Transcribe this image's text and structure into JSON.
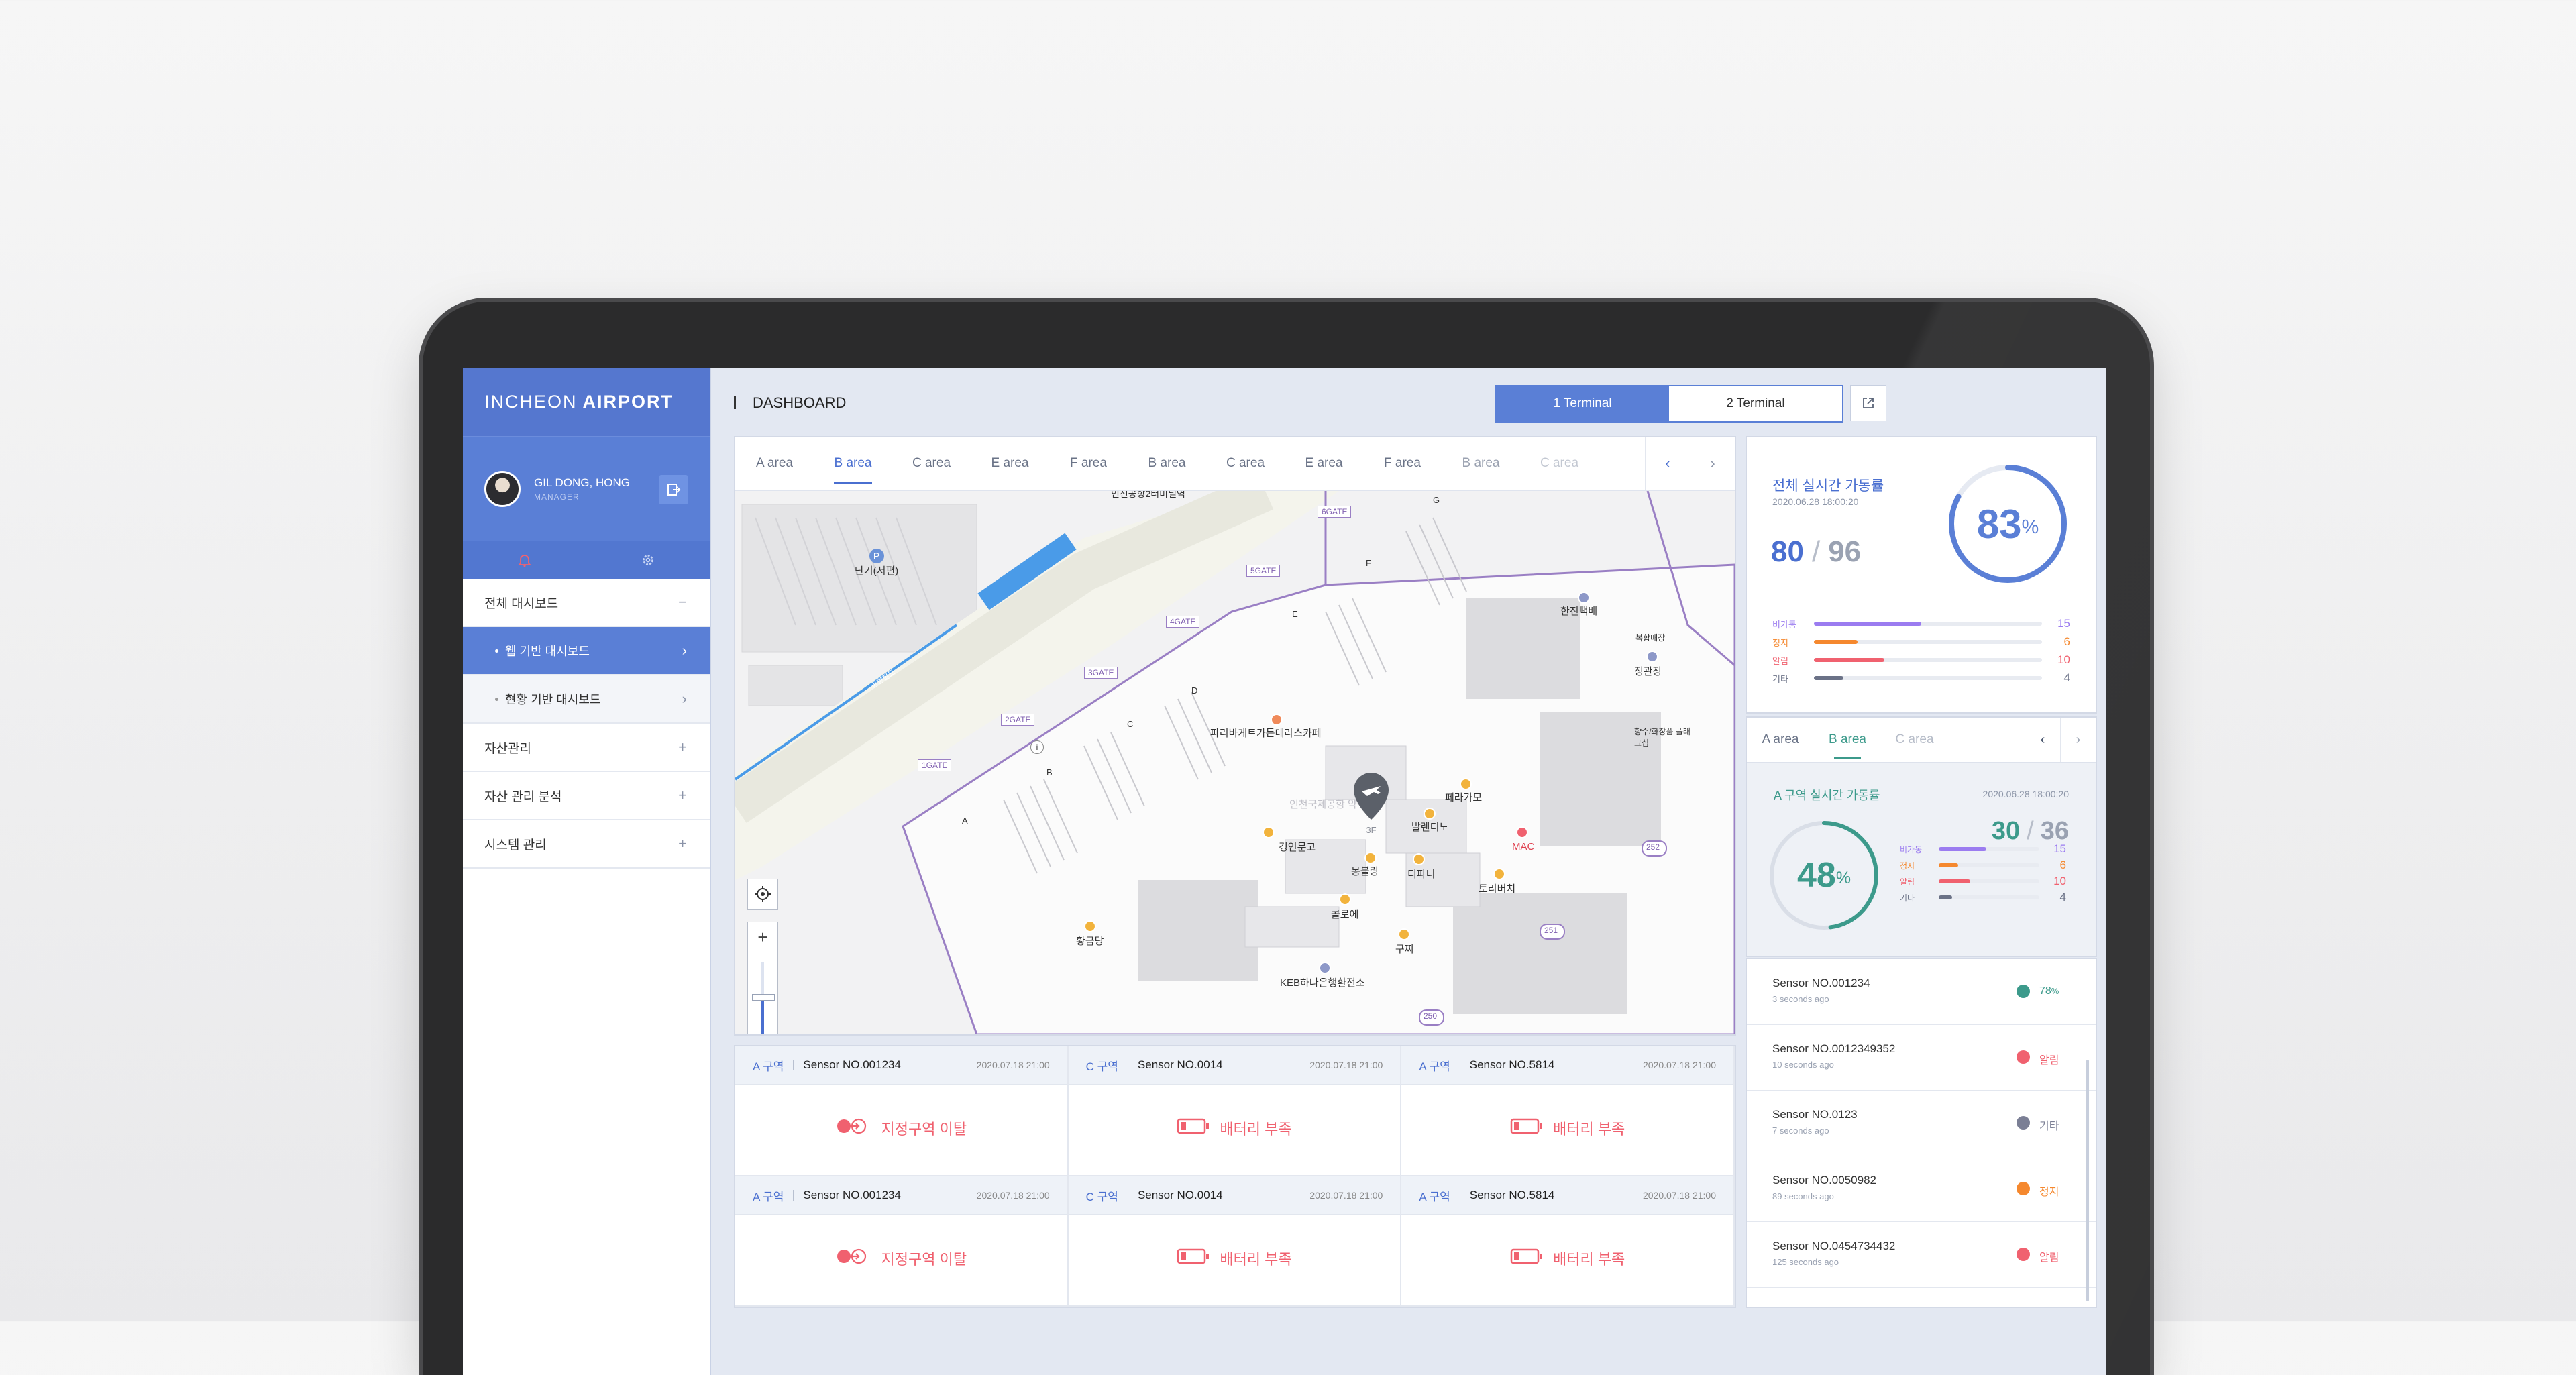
{
  "brand": {
    "light": "INCHEON",
    "bold": "AIRPORT"
  },
  "user": {
    "name": "GIL DONG, HONG",
    "role": "MANAGER"
  },
  "sidebar": {
    "items": [
      {
        "label": "전체 대시보드",
        "mark": "−"
      },
      {
        "label": "웹 기반 대시보드",
        "mark": "›"
      },
      {
        "label": "현황 기반 대시보드",
        "mark": "›"
      },
      {
        "label": "자산관리",
        "mark": "+"
      },
      {
        "label": "자산 관리 분석",
        "mark": "+"
      },
      {
        "label": "시스템 관리",
        "mark": "+"
      }
    ]
  },
  "header": {
    "title": "DASHBOARD",
    "terminal1": "1 Terminal",
    "terminal2": "2 Terminal"
  },
  "area_tabs": [
    "A area",
    "B area",
    "C area",
    "E area",
    "F area",
    "B area",
    "C area",
    "E area",
    "F area",
    "B area",
    "C area"
  ],
  "map": {
    "gates": [
      "1GATE",
      "2GATE",
      "3GATE",
      "4GATE",
      "5GATE",
      "6GATE"
    ],
    "zones": [
      "A",
      "B",
      "C",
      "D",
      "E",
      "F",
      "G"
    ],
    "places": [
      "단기(서편)",
      "인천공항2터미널역",
      "파리바게트가든테라스카페",
      "한진택배",
      "복합매장",
      "정관장",
      "향수/화장품 플래그십",
      "경인문고",
      "발렌티노",
      "페라가모",
      "몽블랑",
      "티파니",
      "MAC",
      "토리버치",
      "콜로에",
      "구찌",
      "황금당",
      "KEB하나은행환전소",
      "인천국제공항 약국",
      "공항철도"
    ],
    "road_numbers": [
      "252",
      "251",
      "250"
    ],
    "marker_label": "3F"
  },
  "alerts": [
    {
      "zone": "A 구역",
      "sensor": "Sensor NO.001234",
      "date": "2020.07.18  21:00",
      "message": "지정구역 이탈",
      "icon": "exit-zone-icon"
    },
    {
      "zone": "C 구역",
      "sensor": "Sensor NO.0014",
      "date": "2020.07.18  21:00",
      "message": "배터리 부족",
      "icon": "low-battery-icon"
    },
    {
      "zone": "A 구역",
      "sensor": "Sensor NO.5814",
      "date": "2020.07.18  21:00",
      "message": "배터리 부족",
      "icon": "low-battery-icon"
    },
    {
      "zone": "A 구역",
      "sensor": "Sensor NO.001234",
      "date": "2020.07.18  21:00",
      "message": "지정구역 이탈",
      "icon": "exit-zone-icon"
    },
    {
      "zone": "C 구역",
      "sensor": "Sensor NO.0014",
      "date": "2020.07.18  21:00",
      "message": "배터리 부족",
      "icon": "low-battery-icon"
    },
    {
      "zone": "A 구역",
      "sensor": "Sensor NO.5814",
      "date": "2020.07.18  21:00",
      "message": "배터리 부족",
      "icon": "low-battery-icon"
    }
  ],
  "overall": {
    "title": "전체 실시간 가동률",
    "date": "2020.06.28  18:00:20",
    "active": "80",
    "total": "96",
    "percent": "83",
    "unit": "%",
    "stats": [
      {
        "label": "비가동",
        "value": "15",
        "fill": 0.47,
        "color": "#9b7cf0"
      },
      {
        "label": "정지",
        "value": "6",
        "fill": 0.19,
        "color": "#f5882e"
      },
      {
        "label": "알림",
        "value": "10",
        "fill": 0.31,
        "color": "#f0616f"
      },
      {
        "label": "기타",
        "value": "4",
        "fill": 0.13,
        "color": "#6b7287"
      }
    ]
  },
  "area_panel": {
    "tabs": [
      "A area",
      "B area",
      "C area"
    ],
    "title": "A 구역 실시간 가동률",
    "date": "2020.06.28  18:00:20",
    "active": "30",
    "total": "36",
    "percent": "48",
    "unit": "%",
    "stats": [
      {
        "label": "비가동",
        "value": "15",
        "fill": 0.47,
        "color": "#9b7cf0"
      },
      {
        "label": "정지",
        "value": "6",
        "fill": 0.19,
        "color": "#f5882e"
      },
      {
        "label": "알림",
        "value": "10",
        "fill": 0.31,
        "color": "#f0616f"
      },
      {
        "label": "기타",
        "value": "4",
        "fill": 0.13,
        "color": "#6b7287"
      }
    ]
  },
  "sensors": [
    {
      "name": "Sensor NO.001234",
      "ago": "3 seconds ago",
      "status": "78",
      "unit": "%",
      "color": "#3c9a8b"
    },
    {
      "name": "Sensor NO.0012349352",
      "ago": "10 seconds ago",
      "status": "알림",
      "unit": "",
      "color": "#f0616f"
    },
    {
      "name": "Sensor NO.0123",
      "ago": "7 seconds ago",
      "status": "기타",
      "unit": "",
      "color": "#7b7f95"
    },
    {
      "name": "Sensor NO.0050982",
      "ago": "89 seconds ago",
      "status": "정지",
      "unit": "",
      "color": "#f5882e"
    },
    {
      "name": "Sensor NO.0454734432",
      "ago": "125 seconds ago",
      "status": "알림",
      "unit": "",
      "color": "#f0616f"
    }
  ],
  "zoom_level": 0.65
}
